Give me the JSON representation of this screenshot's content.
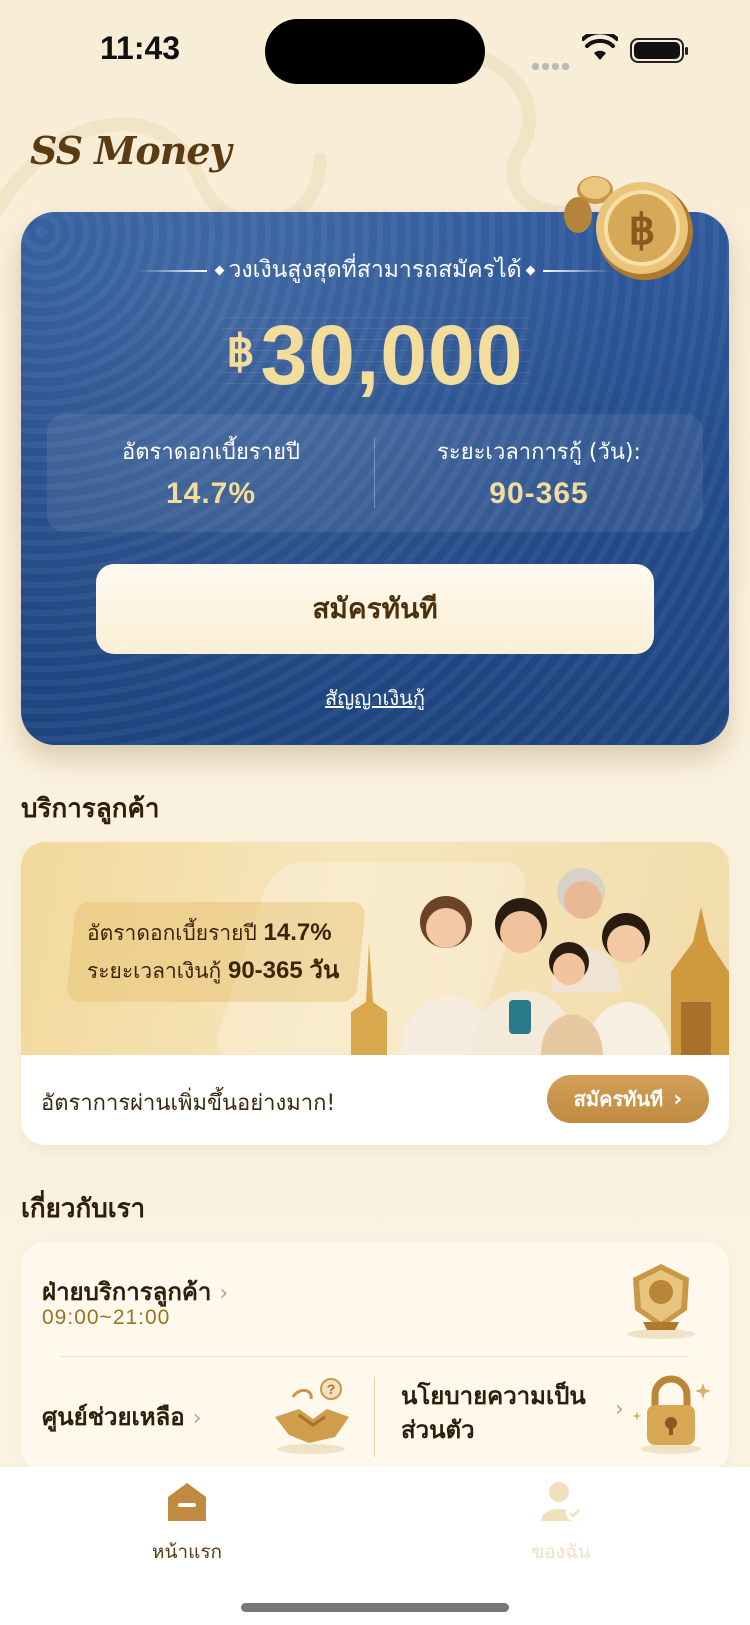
{
  "status_bar": {
    "time": "11:43"
  },
  "app": {
    "logo": "SS Money"
  },
  "hero": {
    "subtitle": "วงเงินสูงสุดที่สามารถสมัครได้",
    "currency": "฿",
    "amount": "30,000",
    "interest_label": "อัตราดอกเบี้ยรายปี",
    "interest_value": "14.7%",
    "term_label": "ระยะเวลาการกู้ (วัน):",
    "term_value": "90-365",
    "apply_label": "สมัครทันที",
    "contract_link": "สัญญาเงินกู้"
  },
  "service": {
    "section_title": "บริการลูกค้า",
    "banner_line1_text": "อัตราดอกเบี้ยรายปี",
    "banner_line1_value": "14.7%",
    "banner_line2_text": "ระยะเวลาเงินกู้",
    "banner_line2_value": "90-365 วัน",
    "tagline": "อัตราการผ่านเพิ่มขึ้นอย่างมาก!",
    "apply_label": "สมัครทันที"
  },
  "about": {
    "section_title": "เกี่ยวกับเรา",
    "customer_service_label": "ฝ่ายบริการลูกค้า",
    "customer_service_hours": "09:00~21:00",
    "help_center_label": "ศูนย์ช่วยเหลือ",
    "privacy_label": "นโยบายความเป็นส่วนตัว"
  },
  "tabbar": {
    "home_label": "หน้าแรก",
    "mine_label": "ของฉัน",
    "home_icon": "home-icon",
    "mine_icon": "user-icon"
  },
  "colors": {
    "brand_gold": "#c08a40",
    "hero_blue": "#244c8a",
    "amount_gold": "#f3dd9c"
  }
}
